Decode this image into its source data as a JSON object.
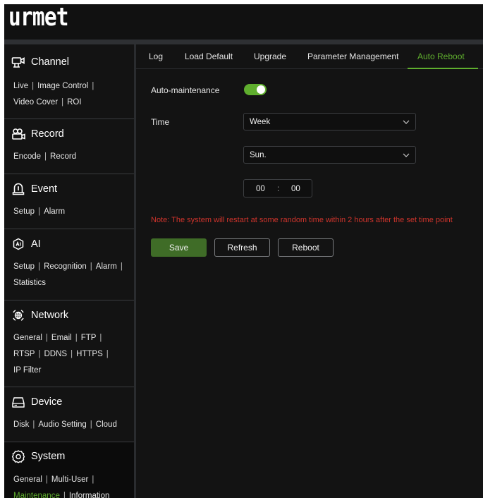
{
  "brand": {
    "logo_text": "urmet"
  },
  "colors": {
    "accent": "#5fae2e",
    "note": "#d0342c",
    "save_button": "#3f6c27"
  },
  "sidebar": {
    "sections": [
      {
        "title": "Channel",
        "icon": "channel-icon",
        "links": [
          "Live",
          "Image Control",
          "Video Cover",
          "ROI"
        ]
      },
      {
        "title": "Record",
        "icon": "record-icon",
        "links": [
          "Encode",
          "Record"
        ]
      },
      {
        "title": "Event",
        "icon": "event-icon",
        "links": [
          "Setup",
          "Alarm"
        ]
      },
      {
        "title": "AI",
        "icon": "ai-icon",
        "links": [
          "Setup",
          "Recognition",
          "Alarm",
          "Statistics"
        ]
      },
      {
        "title": "Network",
        "icon": "network-icon",
        "links": [
          "General",
          "Email",
          "FTP",
          "RTSP",
          "DDNS",
          "HTTPS",
          "IP Filter"
        ]
      },
      {
        "title": "Device",
        "icon": "device-icon",
        "links": [
          "Disk",
          "Audio Setting",
          "Cloud"
        ]
      },
      {
        "title": "System",
        "icon": "system-icon",
        "links": [
          "General",
          "Multi-User",
          "Maintenance",
          "Information"
        ],
        "active": true,
        "active_link": "Maintenance"
      }
    ]
  },
  "tabs": [
    {
      "label": "Log"
    },
    {
      "label": "Load Default"
    },
    {
      "label": "Upgrade"
    },
    {
      "label": "Parameter Management"
    },
    {
      "label": "Auto Reboot",
      "active": true
    }
  ],
  "form": {
    "auto_maintenance_label": "Auto-maintenance",
    "auto_maintenance_enabled": true,
    "time_label": "Time",
    "period_value": "Week",
    "day_value": "Sun.",
    "hour": "00",
    "minute": "00",
    "time_separator": ":",
    "note": "Note: The system will restart at some random time within 2 hours after the set time point"
  },
  "buttons": {
    "save": "Save",
    "refresh": "Refresh",
    "reboot": "Reboot"
  },
  "separator": "|"
}
